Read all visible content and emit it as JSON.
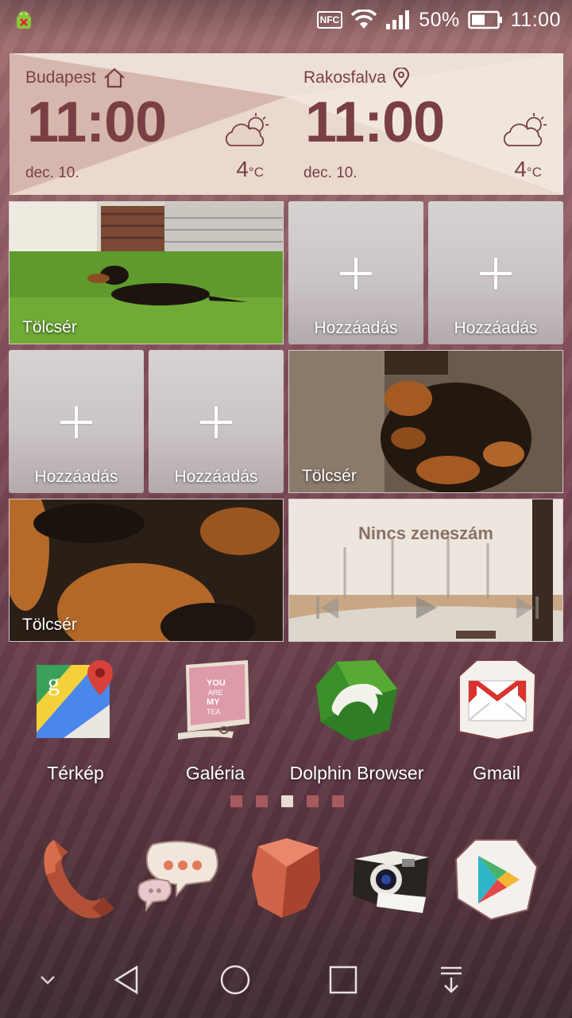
{
  "status_bar": {
    "nfc": "NFC",
    "battery": "50%",
    "time": "11:00"
  },
  "weather": {
    "cities": [
      {
        "name": "Budapest",
        "icon": "home-icon",
        "time": "11:00",
        "date": "dec. 10.",
        "temp": "4",
        "unit": "°C",
        "condition": "partly-cloudy"
      },
      {
        "name": "Rakosfalva",
        "icon": "location-pin-icon",
        "time": "11:00",
        "date": "dec. 10.",
        "temp": "4",
        "unit": "°C",
        "condition": "partly-cloudy"
      }
    ]
  },
  "tiles": {
    "photo_label": "Tölcsér",
    "add_label": "Hozzáadás",
    "music": {
      "title": "Nincs zeneszám"
    }
  },
  "apps": [
    {
      "label": "Térkép",
      "icon": "maps-icon"
    },
    {
      "label": "Galéria",
      "icon": "gallery-icon"
    },
    {
      "label": "Dolphin Browser",
      "icon": "dolphin-browser-icon"
    },
    {
      "label": "Gmail",
      "icon": "gmail-icon"
    }
  ],
  "page_indicator": {
    "count": 5,
    "active": 3
  },
  "dock": [
    "phone-icon",
    "messages-icon",
    "browser-icon",
    "camera-icon",
    "play-store-icon"
  ],
  "colors": {
    "accent": "#7a3f44",
    "dot": "#a65a5e",
    "dot_active": "#e6dcd2"
  }
}
